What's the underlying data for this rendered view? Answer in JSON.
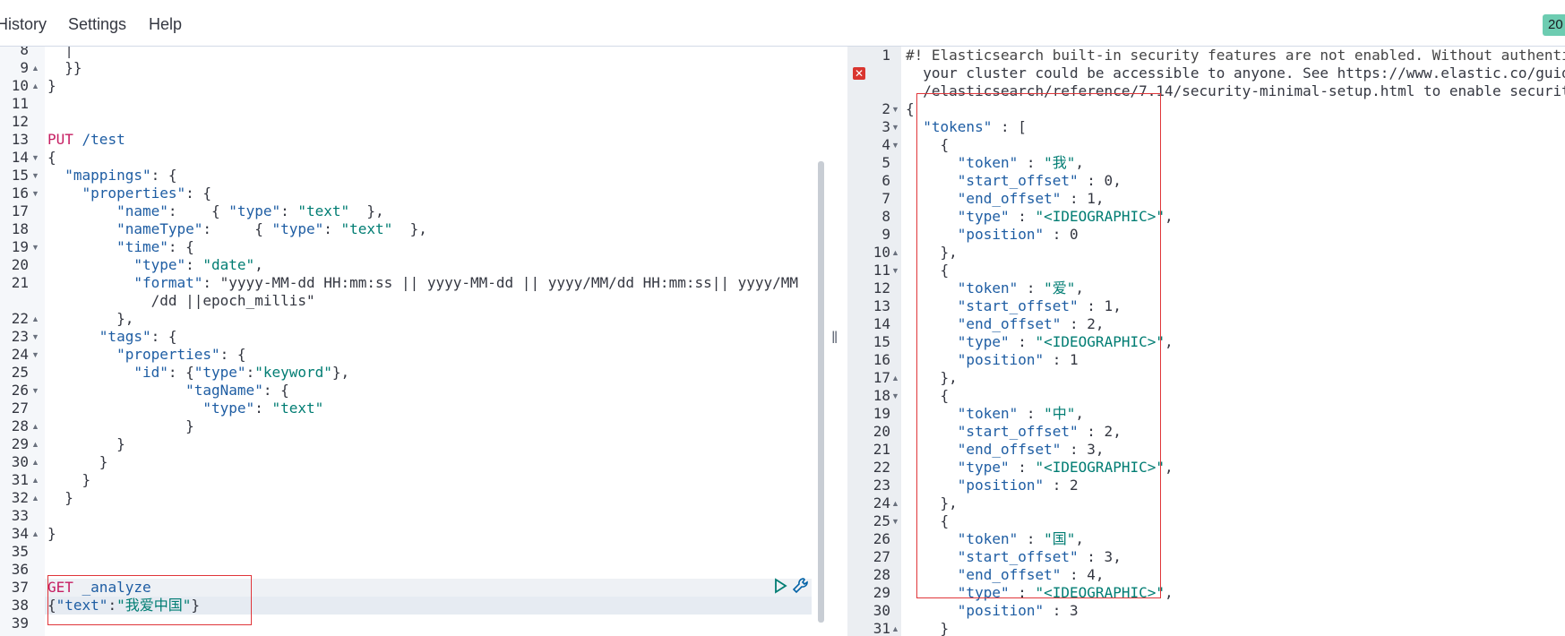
{
  "menu": {
    "history": "History",
    "settings": "Settings",
    "help": "Help"
  },
  "status_badge": "20",
  "request_lines": [
    {
      "n": "8",
      "fold": "",
      "text": "  │"
    },
    {
      "n": "9",
      "fold": "▲",
      "text": "  }}"
    },
    {
      "n": "10",
      "fold": "▲",
      "text": "}"
    },
    {
      "n": "11",
      "fold": "",
      "text": ""
    },
    {
      "n": "12",
      "fold": "",
      "text": ""
    },
    {
      "n": "13",
      "fold": "",
      "text": "PUT /test"
    },
    {
      "n": "14",
      "fold": "▼",
      "text": "{"
    },
    {
      "n": "15",
      "fold": "▼",
      "text": "  \"mappings\": {"
    },
    {
      "n": "16",
      "fold": "▼",
      "text": "    \"properties\": {"
    },
    {
      "n": "17",
      "fold": "",
      "text": "        \"name\":    { \"type\": \"text\"  },"
    },
    {
      "n": "18",
      "fold": "",
      "text": "        \"nameType\":     { \"type\": \"text\"  },"
    },
    {
      "n": "19",
      "fold": "▼",
      "text": "        \"time\": {"
    },
    {
      "n": "20",
      "fold": "",
      "text": "          \"type\": \"date\","
    },
    {
      "n": "21",
      "fold": "",
      "text": "          \"format\": \"yyyy-MM-dd HH:mm:ss || yyyy-MM-dd || yyyy/MM/dd HH:mm:ss|| yyyy/MM"
    },
    {
      "n": "",
      "fold": "",
      "text": "            /dd ||epoch_millis\""
    },
    {
      "n": "22",
      "fold": "▲",
      "text": "        },"
    },
    {
      "n": "23",
      "fold": "▼",
      "text": "      \"tags\": {"
    },
    {
      "n": "24",
      "fold": "▼",
      "text": "        \"properties\": {"
    },
    {
      "n": "25",
      "fold": "",
      "text": "          \"id\": {\"type\":\"keyword\"},"
    },
    {
      "n": "26",
      "fold": "▼",
      "text": "                \"tagName\": {"
    },
    {
      "n": "27",
      "fold": "",
      "text": "                  \"type\": \"text\""
    },
    {
      "n": "28",
      "fold": "▲",
      "text": "                }"
    },
    {
      "n": "29",
      "fold": "▲",
      "text": "        }"
    },
    {
      "n": "30",
      "fold": "▲",
      "text": "      }"
    },
    {
      "n": "31",
      "fold": "▲",
      "text": "    }"
    },
    {
      "n": "32",
      "fold": "▲",
      "text": "  }"
    },
    {
      "n": "33",
      "fold": "",
      "text": ""
    },
    {
      "n": "34",
      "fold": "▲",
      "text": "}"
    },
    {
      "n": "35",
      "fold": "",
      "text": ""
    },
    {
      "n": "36",
      "fold": "",
      "text": ""
    },
    {
      "n": "37",
      "fold": "",
      "text": "GET _analyze"
    },
    {
      "n": "38",
      "fold": "",
      "text": "{\"text\":\"我爱中国\"}"
    },
    {
      "n": "39",
      "fold": "",
      "text": ""
    }
  ],
  "response_lines": [
    {
      "n": "1",
      "fold": "",
      "text": "#! Elasticsearch built-in security features are not enabled. Without authenti"
    },
    {
      "n": "",
      "fold": "",
      "text": "  your cluster could be accessible to anyone. See https://www.elastic.co/guid"
    },
    {
      "n": "",
      "fold": "",
      "text": "  /elasticsearch/reference/7.14/security-minimal-setup.html to enable securit"
    },
    {
      "n": "2",
      "fold": "▼",
      "text": "{"
    },
    {
      "n": "3",
      "fold": "▼",
      "text": "  \"tokens\" : ["
    },
    {
      "n": "4",
      "fold": "▼",
      "text": "    {"
    },
    {
      "n": "5",
      "fold": "",
      "text": "      \"token\" : \"我\","
    },
    {
      "n": "6",
      "fold": "",
      "text": "      \"start_offset\" : 0,"
    },
    {
      "n": "7",
      "fold": "",
      "text": "      \"end_offset\" : 1,"
    },
    {
      "n": "8",
      "fold": "",
      "text": "      \"type\" : \"<IDEOGRAPHIC>\","
    },
    {
      "n": "9",
      "fold": "",
      "text": "      \"position\" : 0"
    },
    {
      "n": "10",
      "fold": "▲",
      "text": "    },"
    },
    {
      "n": "11",
      "fold": "▼",
      "text": "    {"
    },
    {
      "n": "12",
      "fold": "",
      "text": "      \"token\" : \"爱\","
    },
    {
      "n": "13",
      "fold": "",
      "text": "      \"start_offset\" : 1,"
    },
    {
      "n": "14",
      "fold": "",
      "text": "      \"end_offset\" : 2,"
    },
    {
      "n": "15",
      "fold": "",
      "text": "      \"type\" : \"<IDEOGRAPHIC>\","
    },
    {
      "n": "16",
      "fold": "",
      "text": "      \"position\" : 1"
    },
    {
      "n": "17",
      "fold": "▲",
      "text": "    },"
    },
    {
      "n": "18",
      "fold": "▼",
      "text": "    {"
    },
    {
      "n": "19",
      "fold": "",
      "text": "      \"token\" : \"中\","
    },
    {
      "n": "20",
      "fold": "",
      "text": "      \"start_offset\" : 2,"
    },
    {
      "n": "21",
      "fold": "",
      "text": "      \"end_offset\" : 3,"
    },
    {
      "n": "22",
      "fold": "",
      "text": "      \"type\" : \"<IDEOGRAPHIC>\","
    },
    {
      "n": "23",
      "fold": "",
      "text": "      \"position\" : 2"
    },
    {
      "n": "24",
      "fold": "▲",
      "text": "    },"
    },
    {
      "n": "25",
      "fold": "▼",
      "text": "    {"
    },
    {
      "n": "26",
      "fold": "",
      "text": "      \"token\" : \"国\","
    },
    {
      "n": "27",
      "fold": "",
      "text": "      \"start_offset\" : 3,"
    },
    {
      "n": "28",
      "fold": "",
      "text": "      \"end_offset\" : 4,"
    },
    {
      "n": "29",
      "fold": "",
      "text": "      \"type\" : \"<IDEOGRAPHIC>\","
    },
    {
      "n": "30",
      "fold": "",
      "text": "      \"position\" : 3"
    },
    {
      "n": "31",
      "fold": "▲",
      "text": "    }"
    }
  ],
  "icons": {
    "run": "play-icon",
    "settings": "wrench-icon",
    "error": "error-icon",
    "resizer": "resize-grip-icon"
  },
  "resizer_glyph": "‖",
  "error_glyph": "✕",
  "colors": {
    "keyword": "#1e5da3",
    "string": "#017d73",
    "method": "#c61e62",
    "annotation": "#e0363a"
  }
}
